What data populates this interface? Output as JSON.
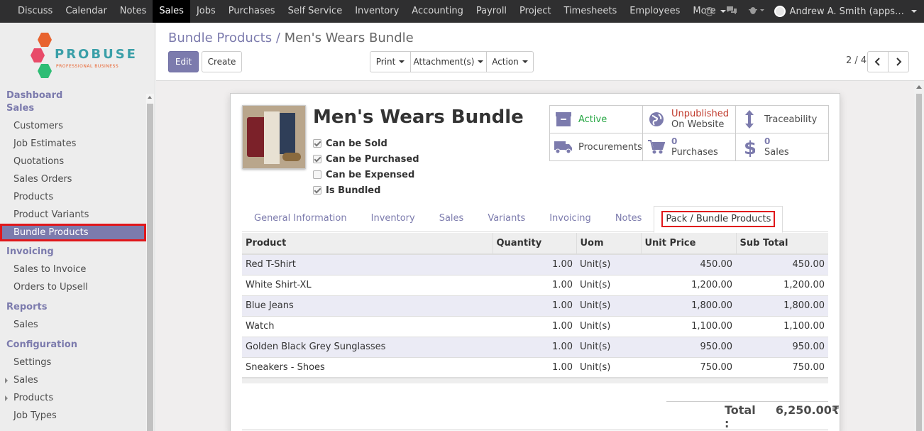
{
  "topnav": {
    "items": [
      "Discuss",
      "Calendar",
      "Notes",
      "Sales",
      "Jobs",
      "Purchases",
      "Self Service",
      "Inventory",
      "Accounting",
      "Payroll",
      "Project",
      "Timesheets",
      "Employees"
    ],
    "more_label": "More",
    "user_name": "Andrew A. Smith (apps…"
  },
  "logo": {
    "text": "PROBUSE",
    "sub": "PROFESSIONAL BUSINESS"
  },
  "sidebar": {
    "dashboard": "Dashboard",
    "sales_hdr": "Sales",
    "sales_items": [
      "Customers",
      "Job Estimates",
      "Quotations",
      "Sales Orders",
      "Products",
      "Product Variants",
      "Bundle Products"
    ],
    "invoicing_hdr": "Invoicing",
    "invoicing_items": [
      "Sales to Invoice",
      "Orders to Upsell"
    ],
    "reports_hdr": "Reports",
    "reports_items": [
      "Sales"
    ],
    "config_hdr": "Configuration",
    "config_items": [
      "Settings",
      "Sales",
      "Products",
      "Job Types"
    ]
  },
  "breadcrumb": {
    "parent": "Bundle Products",
    "sep": " / ",
    "current": "Men's Wears Bundle"
  },
  "buttons": {
    "edit": "Edit",
    "create": "Create",
    "print": "Print",
    "attachments": "Attachment(s)",
    "action": "Action"
  },
  "pager": {
    "text": "2 / 4"
  },
  "product": {
    "name": "Men's Wears Bundle",
    "checks": [
      {
        "label": "Can be Sold",
        "checked": true
      },
      {
        "label": "Can be Purchased",
        "checked": true
      },
      {
        "label": "Can be Expensed",
        "checked": false
      },
      {
        "label": "Is Bundled",
        "checked": true
      }
    ]
  },
  "smart_buttons": {
    "active": "Active",
    "unpublished": "Unpublished",
    "on_website": "On Website",
    "traceability": "Traceability",
    "procurements": "Procurements",
    "purchases_count": "0",
    "purchases_label": "Purchases",
    "sales_count": "0",
    "sales_label": "Sales"
  },
  "tabs": [
    "General Information",
    "Inventory",
    "Sales",
    "Variants",
    "Invoicing",
    "Notes",
    "Pack / Bundle Products"
  ],
  "table": {
    "headers": [
      "Product",
      "Quantity",
      "Uom",
      "Unit Price",
      "Sub Total"
    ],
    "rows": [
      [
        "Red T-Shirt",
        "1.00",
        "Unit(s)",
        "450.00",
        "450.00"
      ],
      [
        "White Shirt-XL",
        "1.00",
        "Unit(s)",
        "1,200.00",
        "1,200.00"
      ],
      [
        "Blue Jeans",
        "1.00",
        "Unit(s)",
        "1,800.00",
        "1,800.00"
      ],
      [
        "Watch",
        "1.00",
        "Unit(s)",
        "1,100.00",
        "1,100.00"
      ],
      [
        "Golden Black Grey Sunglasses",
        "1.00",
        "Unit(s)",
        "950.00",
        "950.00"
      ],
      [
        "Sneakers - Shoes",
        "1.00",
        "Unit(s)",
        "750.00",
        "750.00"
      ]
    ]
  },
  "total": {
    "label": "Total :",
    "value": "6,250.00₹"
  },
  "colors": {
    "primary": "#7c7bad",
    "highlight": "#e0171b",
    "navbar": "#2f2f30"
  }
}
